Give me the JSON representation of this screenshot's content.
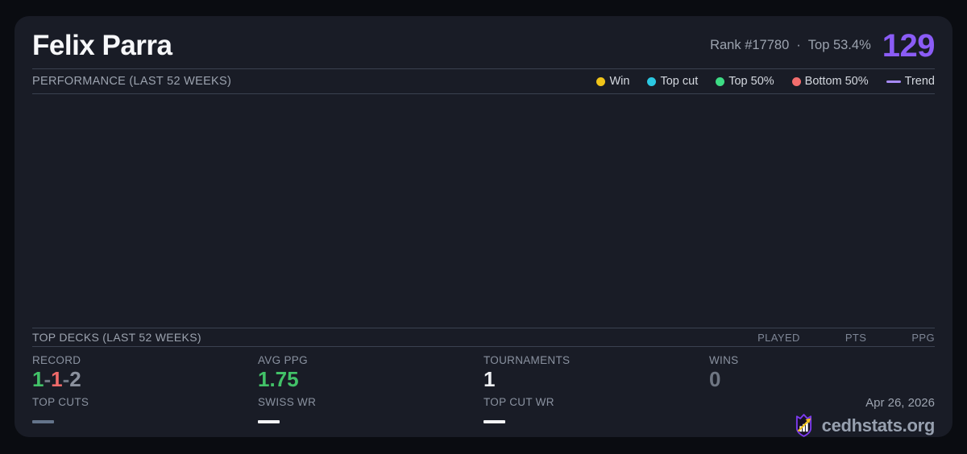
{
  "card": {
    "header": {
      "title": "Felix Parra",
      "rank": "Rank #17780",
      "separator": "·",
      "top_percent": "Top 53.4%",
      "rating": "129"
    },
    "performance": {
      "title": "PERFORMANCE (LAST 52 WEEKS)",
      "legend": [
        {
          "label": "Win",
          "type": "dot",
          "color": "#f0c419"
        },
        {
          "label": "Top cut",
          "type": "dot",
          "color": "#2bc8e2"
        },
        {
          "label": "Top 50%",
          "type": "dot",
          "color": "#3ddc84"
        },
        {
          "label": "Bottom 50%",
          "type": "dot",
          "color": "#f26d6d"
        },
        {
          "label": "Trend",
          "type": "line",
          "color": "#a78bfa"
        }
      ],
      "chart_data": {
        "type": "scatter",
        "points": [],
        "empty": true
      }
    },
    "top_decks": {
      "title": "TOP DECKS (LAST 52 WEEKS)",
      "columns": [
        "PLAYED",
        "PTS",
        "PPG"
      ],
      "rows": []
    },
    "stats": {
      "record": {
        "label": "RECORD",
        "wins": "1",
        "losses": "1",
        "draws": "2",
        "separator": "-"
      },
      "avg_ppg": {
        "label": "AVG PPG",
        "value": "1.75"
      },
      "tournaments": {
        "label": "TOURNAMENTS",
        "value": "1"
      },
      "wins": {
        "label": "WINS",
        "value": "0"
      },
      "top_cuts": {
        "label": "TOP CUTS",
        "value": "—"
      },
      "swiss_wr": {
        "label": "SWISS WR",
        "value": "—"
      },
      "top_cut_wr": {
        "label": "TOP CUT WR",
        "value": "—"
      }
    },
    "footer": {
      "date": "Apr 26, 2026",
      "brand": "cedhstats.org"
    }
  },
  "colors": {
    "accent_purple": "#8b5cf6",
    "trend_purple": "#a78bfa",
    "win_yellow": "#f0c419",
    "topcut_cyan": "#2bc8e2",
    "top50_green": "#3ddc84",
    "bottom50_red": "#f26d6d",
    "positive_green": "#42c268",
    "negative_red": "#ef6a6a",
    "neutral_gray": "#8b919e",
    "muted_gray": "#6f7683",
    "muted_dash": "#64748b",
    "white_dash": "#f3f4f6",
    "card_bg": "#191c26",
    "page_bg": "#0a0c11"
  }
}
